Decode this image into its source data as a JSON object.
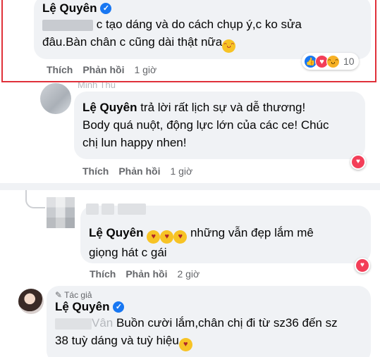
{
  "top_comment": {
    "name": "Lệ Quyên",
    "line1": "c tạo dáng và do cách chụp ý,c ko sửa",
    "line2": "đâu.Bàn chân c cũng dài thật nữa",
    "emoji": "😁",
    "like": "Thích",
    "reply": "Phản hồi",
    "time": "1 giờ",
    "reaction_count": "10"
  },
  "reply_comment": {
    "cut_name": "Minh Thu",
    "mention": "Lệ Quyên",
    "line1": "trả lời rất lịch sự và dễ thương!",
    "line2": "Body quá nuột, động lực lớn của các ce! Chúc",
    "line3": "chị lun happy nhen!",
    "like": "Thích",
    "reply": "Phản hồi",
    "time": "1 giờ"
  },
  "second_comment": {
    "mention": "Lệ Quyên",
    "emojis": "😍😍😍",
    "line1": "những vẫn đẹp lắm mê",
    "line2": "giọng hát c gái",
    "like": "Thích",
    "reply": "Phản hồi",
    "time": "2 giờ"
  },
  "author_reply": {
    "tag": "Tác giả",
    "name": "Lệ Quyên",
    "cut_prefix": "Vân",
    "line1": "Buồn cười lắm,chân chị đi từ sz36 đến sz",
    "line2": "38 tuỳ dáng và tuỳ hiệu",
    "emoji": "🥰"
  },
  "colors": {
    "highlight": "#e0313a",
    "verified": "#1877f2",
    "bubble": "#f0f2f5"
  }
}
